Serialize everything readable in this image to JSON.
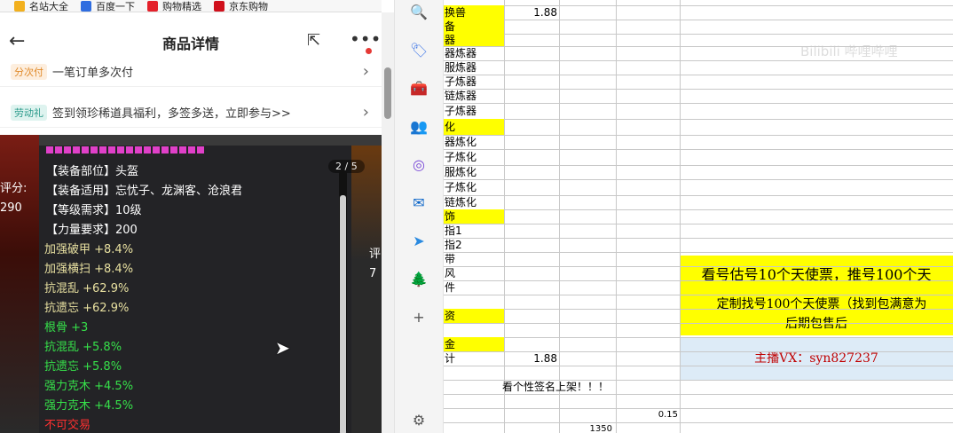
{
  "bookmarks": [
    {
      "label": "名站大全",
      "color": "#f2b01e"
    },
    {
      "label": "百度一下",
      "color": "#2f6de0"
    },
    {
      "label": "购物精选",
      "color": "#e4202a"
    },
    {
      "label": "京东购物",
      "color": "#d0101c"
    }
  ],
  "header": {
    "title": "商品详情",
    "back": "←",
    "share": "⇱",
    "more": "•••"
  },
  "promos": [
    {
      "tag": "分次付",
      "tag_color": "#e08a2a",
      "tag_bg": "#fdeede",
      "text": "一笔订单多次付",
      "chev": "›"
    },
    {
      "tag": "劳动礼",
      "tag_color": "#2a9a8a",
      "tag_bg": "#def3ef",
      "text": "签到领珍稀道具福利，多签多送，立即参与>>",
      "chev": "›"
    }
  ],
  "gallery": {
    "page": "2 / 5",
    "score_label": "评分:",
    "score_value": "290",
    "right_label": "评",
    "right_value": "7",
    "attributes": [
      {
        "text": "【装备部位】头盔",
        "color": "#ffffff"
      },
      {
        "text": "【装备适用】忘忧子、龙渊客、沧浪君",
        "color": "#ffffff"
      },
      {
        "text": "【等级需求】10级",
        "color": "#ffffff"
      },
      {
        "text": "【力量要求】200",
        "color": "#ffffff"
      },
      {
        "text": "加强破甲 +8.4%",
        "color": "#e8e0a0"
      },
      {
        "text": "加强横扫 +8.4%",
        "color": "#e8e0a0"
      },
      {
        "text": "抗混乱 +62.9%",
        "color": "#e8e0a0"
      },
      {
        "text": "抗遗忘 +62.9%",
        "color": "#e8e0a0"
      },
      {
        "text": "根骨 +3",
        "color": "#36e04a"
      },
      {
        "text": "抗混乱 +5.8%",
        "color": "#36e04a"
      },
      {
        "text": "抗遗忘 +5.8%",
        "color": "#36e04a"
      },
      {
        "text": "强力克木 +4.5%",
        "color": "#36e04a"
      },
      {
        "text": "强力克木 +4.5%",
        "color": "#36e04a"
      },
      {
        "text": "不可交易",
        "color": "#ff3030"
      }
    ]
  },
  "sidebar": {
    "icons": [
      "search-icon",
      "tag-icon",
      "briefcase-icon",
      "people-icon",
      "copilot-icon",
      "outlook-icon",
      "send-icon",
      "tree-icon",
      "plus-icon",
      "settings-icon"
    ],
    "glyphs": [
      "🔍",
      "🏷",
      "🧰",
      "👥",
      "◎",
      "✉",
      "➤",
      "🌲",
      "+",
      "⚙"
    ]
  },
  "sheet": {
    "rows": [
      "换兽",
      "备",
      "器",
      "器炼器",
      "服炼器",
      "子炼器",
      "链炼器",
      "子炼器",
      "化",
      "器炼化",
      "子炼化",
      "服炼化",
      "子炼化",
      "链炼化",
      "饰",
      "指1",
      "指2",
      "带",
      "风",
      "件",
      "",
      "资",
      "",
      "金",
      "计",
      ""
    ],
    "yellow_rows": [
      0,
      1,
      2,
      8,
      14,
      21,
      23
    ],
    "value_r0": "1.88",
    "value_total": "1.88",
    "note": "看个性签名上架！！！",
    "num1": "0.15",
    "num2": "1350",
    "banner1": "看号估号10个天使票，推号100个天",
    "banner2a": "定制找号100个天使票（找到包满意为",
    "banner2b": "后期包售后",
    "banner3": "主播VX：syn827237",
    "watermark": "Bilibili 哔哩哔哩"
  }
}
